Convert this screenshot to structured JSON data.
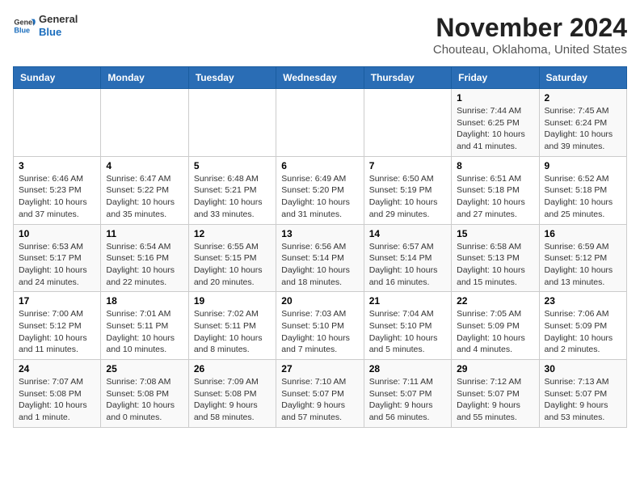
{
  "header": {
    "logo_line1": "General",
    "logo_line2": "Blue",
    "month": "November 2024",
    "location": "Chouteau, Oklahoma, United States"
  },
  "weekdays": [
    "Sunday",
    "Monday",
    "Tuesday",
    "Wednesday",
    "Thursday",
    "Friday",
    "Saturday"
  ],
  "weeks": [
    [
      {
        "day": "",
        "info": ""
      },
      {
        "day": "",
        "info": ""
      },
      {
        "day": "",
        "info": ""
      },
      {
        "day": "",
        "info": ""
      },
      {
        "day": "",
        "info": ""
      },
      {
        "day": "1",
        "info": "Sunrise: 7:44 AM\nSunset: 6:25 PM\nDaylight: 10 hours and 41 minutes."
      },
      {
        "day": "2",
        "info": "Sunrise: 7:45 AM\nSunset: 6:24 PM\nDaylight: 10 hours and 39 minutes."
      }
    ],
    [
      {
        "day": "3",
        "info": "Sunrise: 6:46 AM\nSunset: 5:23 PM\nDaylight: 10 hours and 37 minutes."
      },
      {
        "day": "4",
        "info": "Sunrise: 6:47 AM\nSunset: 5:22 PM\nDaylight: 10 hours and 35 minutes."
      },
      {
        "day": "5",
        "info": "Sunrise: 6:48 AM\nSunset: 5:21 PM\nDaylight: 10 hours and 33 minutes."
      },
      {
        "day": "6",
        "info": "Sunrise: 6:49 AM\nSunset: 5:20 PM\nDaylight: 10 hours and 31 minutes."
      },
      {
        "day": "7",
        "info": "Sunrise: 6:50 AM\nSunset: 5:19 PM\nDaylight: 10 hours and 29 minutes."
      },
      {
        "day": "8",
        "info": "Sunrise: 6:51 AM\nSunset: 5:18 PM\nDaylight: 10 hours and 27 minutes."
      },
      {
        "day": "9",
        "info": "Sunrise: 6:52 AM\nSunset: 5:18 PM\nDaylight: 10 hours and 25 minutes."
      }
    ],
    [
      {
        "day": "10",
        "info": "Sunrise: 6:53 AM\nSunset: 5:17 PM\nDaylight: 10 hours and 24 minutes."
      },
      {
        "day": "11",
        "info": "Sunrise: 6:54 AM\nSunset: 5:16 PM\nDaylight: 10 hours and 22 minutes."
      },
      {
        "day": "12",
        "info": "Sunrise: 6:55 AM\nSunset: 5:15 PM\nDaylight: 10 hours and 20 minutes."
      },
      {
        "day": "13",
        "info": "Sunrise: 6:56 AM\nSunset: 5:14 PM\nDaylight: 10 hours and 18 minutes."
      },
      {
        "day": "14",
        "info": "Sunrise: 6:57 AM\nSunset: 5:14 PM\nDaylight: 10 hours and 16 minutes."
      },
      {
        "day": "15",
        "info": "Sunrise: 6:58 AM\nSunset: 5:13 PM\nDaylight: 10 hours and 15 minutes."
      },
      {
        "day": "16",
        "info": "Sunrise: 6:59 AM\nSunset: 5:12 PM\nDaylight: 10 hours and 13 minutes."
      }
    ],
    [
      {
        "day": "17",
        "info": "Sunrise: 7:00 AM\nSunset: 5:12 PM\nDaylight: 10 hours and 11 minutes."
      },
      {
        "day": "18",
        "info": "Sunrise: 7:01 AM\nSunset: 5:11 PM\nDaylight: 10 hours and 10 minutes."
      },
      {
        "day": "19",
        "info": "Sunrise: 7:02 AM\nSunset: 5:11 PM\nDaylight: 10 hours and 8 minutes."
      },
      {
        "day": "20",
        "info": "Sunrise: 7:03 AM\nSunset: 5:10 PM\nDaylight: 10 hours and 7 minutes."
      },
      {
        "day": "21",
        "info": "Sunrise: 7:04 AM\nSunset: 5:10 PM\nDaylight: 10 hours and 5 minutes."
      },
      {
        "day": "22",
        "info": "Sunrise: 7:05 AM\nSunset: 5:09 PM\nDaylight: 10 hours and 4 minutes."
      },
      {
        "day": "23",
        "info": "Sunrise: 7:06 AM\nSunset: 5:09 PM\nDaylight: 10 hours and 2 minutes."
      }
    ],
    [
      {
        "day": "24",
        "info": "Sunrise: 7:07 AM\nSunset: 5:08 PM\nDaylight: 10 hours and 1 minute."
      },
      {
        "day": "25",
        "info": "Sunrise: 7:08 AM\nSunset: 5:08 PM\nDaylight: 10 hours and 0 minutes."
      },
      {
        "day": "26",
        "info": "Sunrise: 7:09 AM\nSunset: 5:08 PM\nDaylight: 9 hours and 58 minutes."
      },
      {
        "day": "27",
        "info": "Sunrise: 7:10 AM\nSunset: 5:07 PM\nDaylight: 9 hours and 57 minutes."
      },
      {
        "day": "28",
        "info": "Sunrise: 7:11 AM\nSunset: 5:07 PM\nDaylight: 9 hours and 56 minutes."
      },
      {
        "day": "29",
        "info": "Sunrise: 7:12 AM\nSunset: 5:07 PM\nDaylight: 9 hours and 55 minutes."
      },
      {
        "day": "30",
        "info": "Sunrise: 7:13 AM\nSunset: 5:07 PM\nDaylight: 9 hours and 53 minutes."
      }
    ]
  ]
}
